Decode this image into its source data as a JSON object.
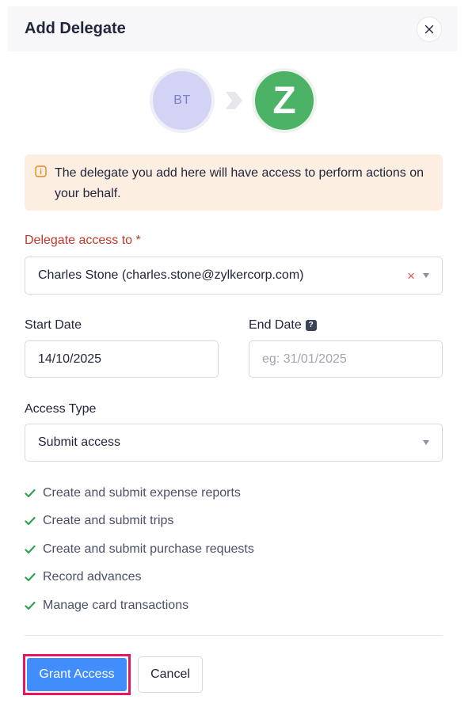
{
  "dialog": {
    "title": "Add Delegate"
  },
  "avatars": {
    "from_initials": "BT",
    "to_initial": "Z",
    "icons": [
      "arrow-right-icon",
      "zoho-expense-logo"
    ]
  },
  "info": {
    "text": "The delegate you add here will have access to perform actions on your behalf.",
    "icon": "info-icon"
  },
  "delegate": {
    "label": "Delegate access to",
    "required_mark": "*",
    "value": "Charles Stone (charles.stone@zylkercorp.com)",
    "clear_symbol": "×"
  },
  "start_date": {
    "label": "Start Date",
    "value": "14/10/2025"
  },
  "end_date": {
    "label": "End Date",
    "help_symbol": "?",
    "value": "",
    "placeholder": "eg: 31/01/2025"
  },
  "access_type": {
    "label": "Access Type",
    "value": "Submit access"
  },
  "permissions": [
    "Create and submit expense reports",
    "Create and submit trips",
    "Create and submit purchase requests",
    "Record advances",
    "Manage card transactions"
  ],
  "actions": {
    "grant_label": "Grant Access",
    "cancel_label": "Cancel"
  },
  "colors": {
    "primary": "#408dfb",
    "highlight_border": "#e8175d",
    "required": "#c0392b",
    "check": "#2ea44f",
    "info_bg": "#fdeee2"
  }
}
